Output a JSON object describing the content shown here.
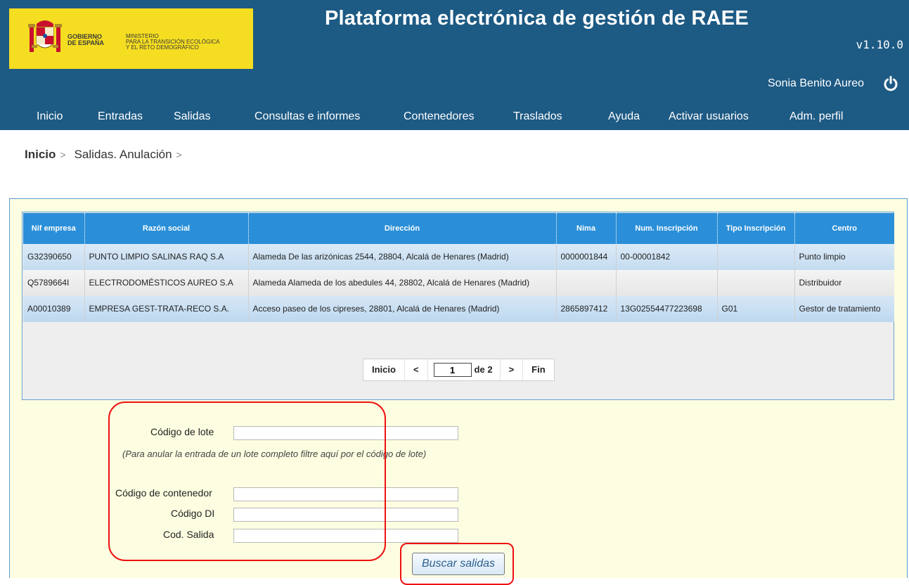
{
  "header": {
    "gov_line": "GOBIERNO\nDE ESPAÑA",
    "ministry_line": "MINISTERIO\nPARA LA TRANSICIÓN ECOLÓGICA\nY EL RETO DEMOGRÁFICO",
    "title": "Plataforma electrónica de gestión de RAEE",
    "version": "v1.10.0",
    "user": "Sonia Benito Aureo",
    "brand_color": "#1d5a84",
    "logo_color": "#f5dd21"
  },
  "nav": {
    "items": [
      {
        "label": "Inicio"
      },
      {
        "label": "Entradas"
      },
      {
        "label": "Salidas"
      },
      {
        "label": "Consultas e informes"
      },
      {
        "label": "Contenedores"
      },
      {
        "label": "Traslados"
      },
      {
        "label": "Ayuda"
      },
      {
        "label": "Activar usuarios"
      },
      {
        "label": "Adm. perfil"
      }
    ]
  },
  "breadcrumb": {
    "home": "Inicio",
    "sep": ">",
    "current": "Salidas. Anulación"
  },
  "table": {
    "headers": {
      "nif": "Nif empresa",
      "razon": "Razón social",
      "direccion": "Dirección",
      "nima": "Nima",
      "num": "Num. Inscripción",
      "tipo": "Tipo Inscripción",
      "centro": "Centro"
    },
    "rows": [
      {
        "nif": "G32390650",
        "razon": "PUNTO LIMPIO SALINAS RAQ S.A",
        "direccion": "Alameda De las arizónicas 2544, 28804, Alcalá de Henares (Madrid)",
        "nima": "0000001844",
        "num": "00-00001842",
        "tipo": "",
        "centro": "Punto limpio"
      },
      {
        "nif": "Q5789664I",
        "razon": "ELECTRODOMÉSTICOS AUREO S.A",
        "direccion": "Alameda Alameda de los abedules 44, 28802, Alcalá de Henares (Madrid)",
        "nima": "",
        "num": "",
        "tipo": "",
        "centro": "Distribuidor"
      },
      {
        "nif": "A00010389",
        "razon": "EMPRESA GEST-TRATA-RECO S.A.",
        "direccion": "Acceso paseo de los cipreses, 28801, Alcalá de Henares (Madrid)",
        "nima": "2865897412",
        "num": "13G02554477223698",
        "tipo": "G01",
        "centro": "Gestor de tratamiento"
      }
    ]
  },
  "pager": {
    "first": "Inicio",
    "prev": "<",
    "page": "1",
    "of": "de 2",
    "next": ">",
    "last": "Fin"
  },
  "form": {
    "lote_label": "Código de lote",
    "lote_value": "",
    "hint": "(Para anular la entrada de un lote completo filtre aquí por el código de lote)",
    "contenedor_label": "Código de contenedor",
    "contenedor_value": "",
    "di_label": "Código DI",
    "di_value": "",
    "salida_label": "Cod. Salida",
    "salida_value": "",
    "search_button": "Buscar salidas"
  }
}
